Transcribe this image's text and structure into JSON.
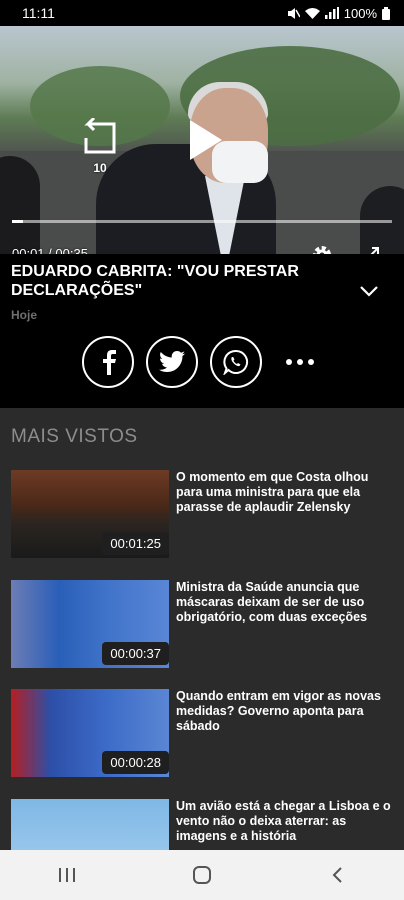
{
  "status_bar": {
    "time": "11:11",
    "battery": "100%"
  },
  "player": {
    "rewind_label": "10",
    "current_time": "00:01",
    "separator": "/",
    "duration": "00:35",
    "progress": 0.03
  },
  "video": {
    "title": "EDUARDO CABRITA: \"VOU PRESTAR DECLARAÇÕES\"",
    "date": "Hoje"
  },
  "share": {
    "icons": [
      "facebook-icon",
      "twitter-icon",
      "whatsapp-icon",
      "more-icon"
    ]
  },
  "most_viewed": {
    "section_title": "MAIS VISTOS",
    "items": [
      {
        "title": "O momento em que Costa olhou para uma ministra para que ela parasse de aplaudir Zelensky",
        "duration": "00:01:25"
      },
      {
        "title": "Ministra da Saúde anuncia que máscaras deixam de ser de uso obrigatório, com duas exceções",
        "duration": "00:00:37"
      },
      {
        "title": "Quando entram em vigor as novas medidas? Governo aponta para sábado",
        "duration": "00:00:28"
      },
      {
        "title": "Um avião está a chegar a Lisboa e o vento não o deixa aterrar: as imagens e a história",
        "duration": ""
      }
    ]
  }
}
